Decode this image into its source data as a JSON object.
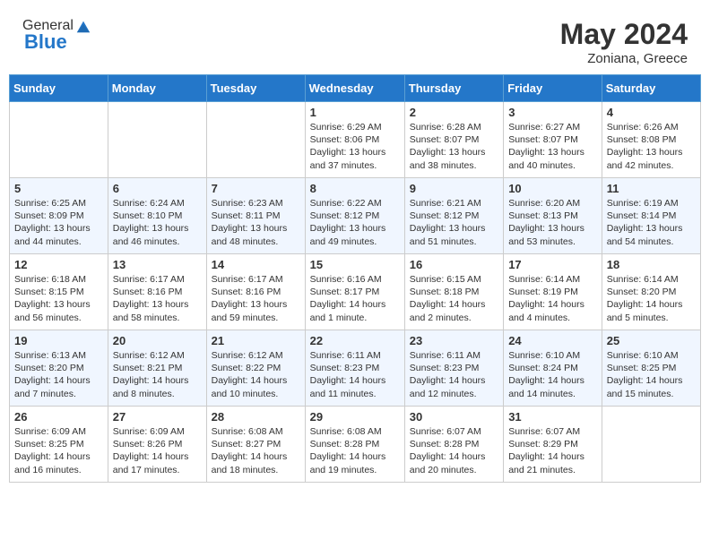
{
  "header": {
    "logo_general": "General",
    "logo_blue": "Blue",
    "title": "May 2024",
    "subtitle": "Zoniana, Greece"
  },
  "days_of_week": [
    "Sunday",
    "Monday",
    "Tuesday",
    "Wednesday",
    "Thursday",
    "Friday",
    "Saturday"
  ],
  "weeks": [
    [
      {
        "day": "",
        "info": ""
      },
      {
        "day": "",
        "info": ""
      },
      {
        "day": "",
        "info": ""
      },
      {
        "day": "1",
        "info": "Sunrise: 6:29 AM\nSunset: 8:06 PM\nDaylight: 13 hours and 37 minutes."
      },
      {
        "day": "2",
        "info": "Sunrise: 6:28 AM\nSunset: 8:07 PM\nDaylight: 13 hours and 38 minutes."
      },
      {
        "day": "3",
        "info": "Sunrise: 6:27 AM\nSunset: 8:07 PM\nDaylight: 13 hours and 40 minutes."
      },
      {
        "day": "4",
        "info": "Sunrise: 6:26 AM\nSunset: 8:08 PM\nDaylight: 13 hours and 42 minutes."
      }
    ],
    [
      {
        "day": "5",
        "info": "Sunrise: 6:25 AM\nSunset: 8:09 PM\nDaylight: 13 hours and 44 minutes."
      },
      {
        "day": "6",
        "info": "Sunrise: 6:24 AM\nSunset: 8:10 PM\nDaylight: 13 hours and 46 minutes."
      },
      {
        "day": "7",
        "info": "Sunrise: 6:23 AM\nSunset: 8:11 PM\nDaylight: 13 hours and 48 minutes."
      },
      {
        "day": "8",
        "info": "Sunrise: 6:22 AM\nSunset: 8:12 PM\nDaylight: 13 hours and 49 minutes."
      },
      {
        "day": "9",
        "info": "Sunrise: 6:21 AM\nSunset: 8:12 PM\nDaylight: 13 hours and 51 minutes."
      },
      {
        "day": "10",
        "info": "Sunrise: 6:20 AM\nSunset: 8:13 PM\nDaylight: 13 hours and 53 minutes."
      },
      {
        "day": "11",
        "info": "Sunrise: 6:19 AM\nSunset: 8:14 PM\nDaylight: 13 hours and 54 minutes."
      }
    ],
    [
      {
        "day": "12",
        "info": "Sunrise: 6:18 AM\nSunset: 8:15 PM\nDaylight: 13 hours and 56 minutes."
      },
      {
        "day": "13",
        "info": "Sunrise: 6:17 AM\nSunset: 8:16 PM\nDaylight: 13 hours and 58 minutes."
      },
      {
        "day": "14",
        "info": "Sunrise: 6:17 AM\nSunset: 8:16 PM\nDaylight: 13 hours and 59 minutes."
      },
      {
        "day": "15",
        "info": "Sunrise: 6:16 AM\nSunset: 8:17 PM\nDaylight: 14 hours and 1 minute."
      },
      {
        "day": "16",
        "info": "Sunrise: 6:15 AM\nSunset: 8:18 PM\nDaylight: 14 hours and 2 minutes."
      },
      {
        "day": "17",
        "info": "Sunrise: 6:14 AM\nSunset: 8:19 PM\nDaylight: 14 hours and 4 minutes."
      },
      {
        "day": "18",
        "info": "Sunrise: 6:14 AM\nSunset: 8:20 PM\nDaylight: 14 hours and 5 minutes."
      }
    ],
    [
      {
        "day": "19",
        "info": "Sunrise: 6:13 AM\nSunset: 8:20 PM\nDaylight: 14 hours and 7 minutes."
      },
      {
        "day": "20",
        "info": "Sunrise: 6:12 AM\nSunset: 8:21 PM\nDaylight: 14 hours and 8 minutes."
      },
      {
        "day": "21",
        "info": "Sunrise: 6:12 AM\nSunset: 8:22 PM\nDaylight: 14 hours and 10 minutes."
      },
      {
        "day": "22",
        "info": "Sunrise: 6:11 AM\nSunset: 8:23 PM\nDaylight: 14 hours and 11 minutes."
      },
      {
        "day": "23",
        "info": "Sunrise: 6:11 AM\nSunset: 8:23 PM\nDaylight: 14 hours and 12 minutes."
      },
      {
        "day": "24",
        "info": "Sunrise: 6:10 AM\nSunset: 8:24 PM\nDaylight: 14 hours and 14 minutes."
      },
      {
        "day": "25",
        "info": "Sunrise: 6:10 AM\nSunset: 8:25 PM\nDaylight: 14 hours and 15 minutes."
      }
    ],
    [
      {
        "day": "26",
        "info": "Sunrise: 6:09 AM\nSunset: 8:25 PM\nDaylight: 14 hours and 16 minutes."
      },
      {
        "day": "27",
        "info": "Sunrise: 6:09 AM\nSunset: 8:26 PM\nDaylight: 14 hours and 17 minutes."
      },
      {
        "day": "28",
        "info": "Sunrise: 6:08 AM\nSunset: 8:27 PM\nDaylight: 14 hours and 18 minutes."
      },
      {
        "day": "29",
        "info": "Sunrise: 6:08 AM\nSunset: 8:28 PM\nDaylight: 14 hours and 19 minutes."
      },
      {
        "day": "30",
        "info": "Sunrise: 6:07 AM\nSunset: 8:28 PM\nDaylight: 14 hours and 20 minutes."
      },
      {
        "day": "31",
        "info": "Sunrise: 6:07 AM\nSunset: 8:29 PM\nDaylight: 14 hours and 21 minutes."
      },
      {
        "day": "",
        "info": ""
      }
    ]
  ]
}
